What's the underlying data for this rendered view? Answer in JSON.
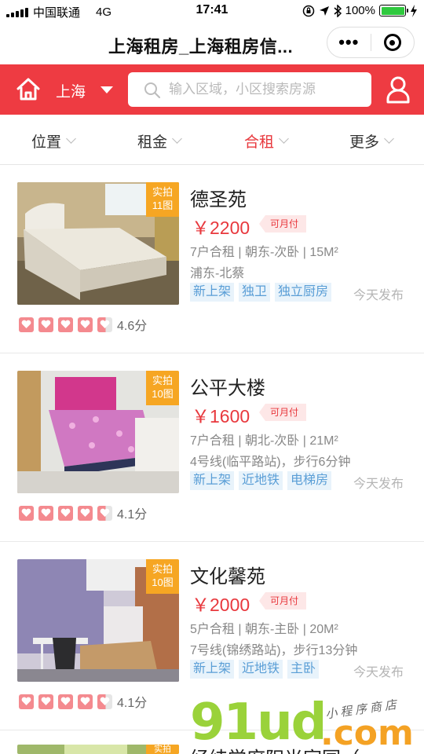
{
  "status_bar": {
    "carrier": "中国联通",
    "network": "4G",
    "time": "17:41",
    "battery": "100%",
    "battery_level": 1.0
  },
  "title_bar": {
    "title": "上海租房_上海租房信...",
    "more_label": "•••"
  },
  "header": {
    "city": "上海",
    "search_placeholder": "输入区域，小区搜索房源",
    "brand_color": "#ee3b42"
  },
  "filters": [
    {
      "label": "位置",
      "active": false
    },
    {
      "label": "租金",
      "active": false
    },
    {
      "label": "合租",
      "active": true
    },
    {
      "label": "更多",
      "active": false
    }
  ],
  "listings": [
    {
      "photo_tag_line1": "实拍",
      "photo_tag_line2": "11图",
      "title": "德圣苑",
      "price": "￥2200",
      "payment": "可月付",
      "detail": "7户合租 | 朝东-次卧 | 15M²",
      "location": "浦东-北蔡",
      "tags": [
        "新上架",
        "独卫",
        "独立厨房"
      ],
      "published": "今天发布",
      "rating": 4.6,
      "score": "4.6分"
    },
    {
      "photo_tag_line1": "实拍",
      "photo_tag_line2": "10图",
      "title": "公平大楼",
      "price": "￥1600",
      "payment": "可月付",
      "detail": "7户合租 | 朝北-次卧 | 21M²",
      "location": "4号线(临平路站)，步行6分钟",
      "tags": [
        "新上架",
        "近地铁",
        "电梯房"
      ],
      "published": "今天发布",
      "rating": 4.1,
      "score": "4.1分"
    },
    {
      "photo_tag_line1": "实拍",
      "photo_tag_line2": "10图",
      "title": "文化馨苑",
      "price": "￥2000",
      "payment": "可月付",
      "detail": "5户合租 | 朝东-主卧 | 20M²",
      "location": "7号线(锦绣路站)，步行13分钟",
      "tags": [
        "新上架",
        "近地铁",
        "主卧"
      ],
      "published": "今天发布",
      "rating": 4.1,
      "score": "4.1分"
    },
    {
      "photo_tag_line1": "实拍",
      "title": "经纬学府阳光家园（"
    }
  ],
  "watermark": {
    "main": "91ud",
    "dot_com": ".com",
    "sub": "小程序商店"
  }
}
